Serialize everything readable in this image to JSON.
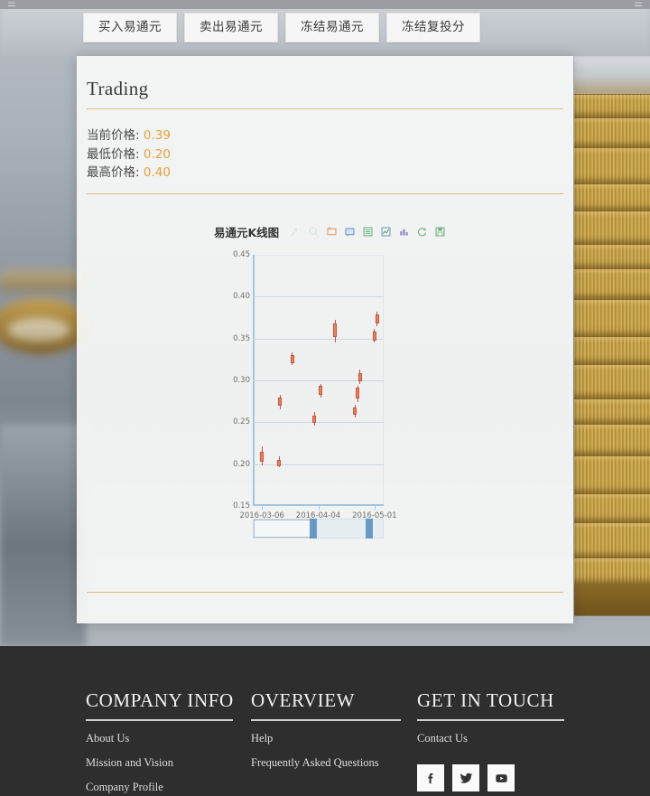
{
  "tabs": [
    {
      "label": "买入易通元",
      "name": "tab-buy"
    },
    {
      "label": "卖出易通元",
      "name": "tab-sell"
    },
    {
      "label": "冻结易通元",
      "name": "tab-freeze"
    },
    {
      "label": "冻结复投分",
      "name": "tab-freeze-reinvest"
    }
  ],
  "panel": {
    "title": "Trading",
    "prices": [
      {
        "label": "当前价格:",
        "value": "0.39"
      },
      {
        "label": "最低价格:",
        "value": "0.20"
      },
      {
        "label": "最高价格:",
        "value": "0.40"
      }
    ]
  },
  "chart_header": {
    "title": "易通元K线图",
    "toolbox": [
      {
        "name": "zoom-select-icon",
        "dim": true
      },
      {
        "name": "zoom-reset-icon",
        "dim": true
      },
      {
        "name": "data-zoom-icon",
        "dim": false
      },
      {
        "name": "data-zoom-reset-icon",
        "dim": false
      },
      {
        "name": "data-view-icon",
        "dim": false
      },
      {
        "name": "line-chart-icon",
        "dim": false
      },
      {
        "name": "bar-chart-icon",
        "dim": false
      },
      {
        "name": "restore-icon",
        "dim": false
      },
      {
        "name": "save-image-icon",
        "dim": false
      }
    ]
  },
  "chart_data": {
    "type": "candlestick",
    "title": "易通元K线图",
    "xlabel": "",
    "ylabel": "",
    "ylim": [
      0.15,
      0.45
    ],
    "yticks": [
      "0.45",
      "0.40",
      "0.35",
      "0.30",
      "0.25",
      "0.20",
      "0.15"
    ],
    "ytick_values": [
      0.45,
      0.4,
      0.35,
      0.3,
      0.25,
      0.2,
      0.15
    ],
    "xticks": [
      "2016-03-06",
      "2016-04-04",
      "2016-05-01"
    ],
    "grid": true,
    "legend": "none",
    "up_color": "#e8845c",
    "down_color": "#c23531",
    "series": [
      {
        "name": "易通元K线",
        "candles": [
          {
            "x": 0.07,
            "open": 0.203,
            "close": 0.215,
            "low": 0.199,
            "high": 0.221
          },
          {
            "x": 0.21,
            "open": 0.27,
            "close": 0.28,
            "low": 0.266,
            "high": 0.283
          },
          {
            "x": 0.3,
            "open": 0.32,
            "close": 0.33,
            "low": 0.318,
            "high": 0.333
          },
          {
            "x": 0.2,
            "open": 0.198,
            "close": 0.205,
            "low": 0.196,
            "high": 0.209
          },
          {
            "x": 0.47,
            "open": 0.249,
            "close": 0.258,
            "low": 0.246,
            "high": 0.262
          },
          {
            "x": 0.52,
            "open": 0.283,
            "close": 0.293,
            "low": 0.28,
            "high": 0.296
          },
          {
            "x": 0.63,
            "open": 0.352,
            "close": 0.368,
            "low": 0.345,
            "high": 0.372
          },
          {
            "x": 0.78,
            "open": 0.259,
            "close": 0.268,
            "low": 0.256,
            "high": 0.271
          },
          {
            "x": 0.8,
            "open": 0.278,
            "close": 0.291,
            "low": 0.274,
            "high": 0.294
          },
          {
            "x": 0.82,
            "open": 0.299,
            "close": 0.309,
            "low": 0.296,
            "high": 0.313
          },
          {
            "x": 0.93,
            "open": 0.348,
            "close": 0.358,
            "low": 0.345,
            "high": 0.361
          },
          {
            "x": 0.95,
            "open": 0.368,
            "close": 0.379,
            "low": 0.365,
            "high": 0.382
          }
        ]
      }
    ],
    "datazoom": {
      "start_pct": 0,
      "end_pct": 46
    }
  },
  "footer": {
    "columns": [
      {
        "heading": "COMPANY INFO",
        "links": [
          "About Us",
          "Mission and Vision",
          "Company Profile"
        ]
      },
      {
        "heading": "OVERVIEW",
        "links": [
          "Help",
          "Frequently Asked Questions"
        ]
      },
      {
        "heading": "GET IN TOUCH",
        "links": [
          "Contact Us"
        ]
      }
    ],
    "social": [
      {
        "name": "facebook-icon"
      },
      {
        "name": "twitter-icon"
      },
      {
        "name": "youtube-icon"
      }
    ]
  }
}
